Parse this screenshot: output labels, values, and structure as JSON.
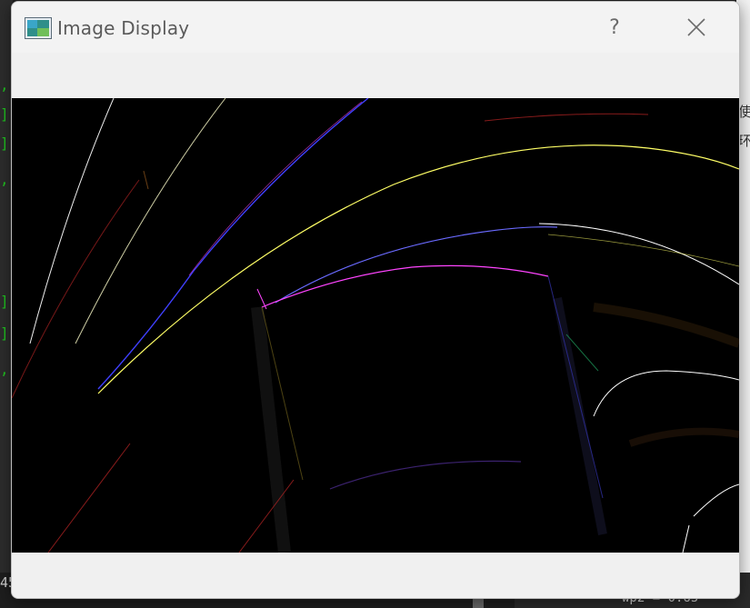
{
  "window": {
    "title": "Image Display",
    "help_label": "?",
    "close_icon": "close-icon",
    "app_icon": "image-app-icon"
  },
  "background": {
    "left_glyphs": [
      ",",
      "]",
      "]",
      ",",
      "]",
      "]",
      ","
    ],
    "bottom_left_code": "45",
    "bottom_right_code": "wp2 = 0.65",
    "right_glyphs": [
      "使",
      "环"
    ]
  },
  "image": {
    "description_colors": [
      "#ffffff",
      "#ffff66",
      "#5555ff",
      "#ff44ff",
      "#aa2222"
    ]
  }
}
